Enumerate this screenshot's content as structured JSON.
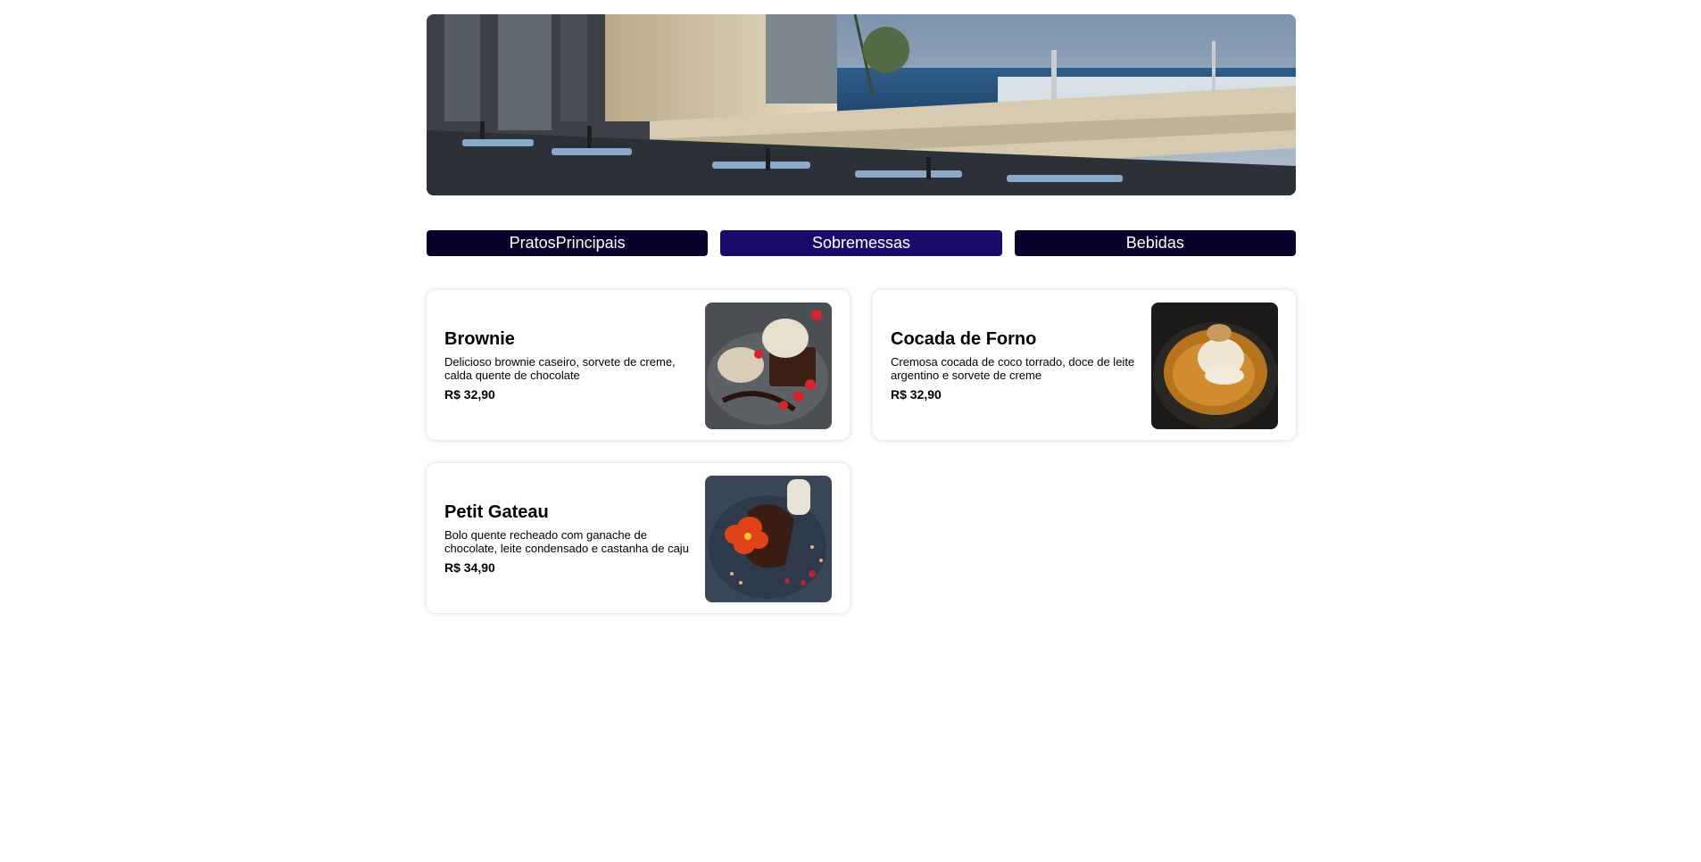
{
  "tabs": [
    {
      "label": "PratosPrincipais",
      "active": false
    },
    {
      "label": "Sobremessas",
      "active": true
    },
    {
      "label": "Bebidas",
      "active": false
    }
  ],
  "items": [
    {
      "name": "Brownie",
      "description": "Delicioso brownie caseiro, sorvete de creme, calda quente de chocolate",
      "price": "R$ 32,90",
      "image_icon": "brownie-photo"
    },
    {
      "name": "Cocada de Forno",
      "description": "Cremosa cocada de coco torrado, doce de leite argentino e sorvete de creme",
      "price": "R$ 32,90",
      "image_icon": "cocada-photo"
    },
    {
      "name": "Petit Gateau",
      "description": "Bolo quente recheado com ganache de chocolate, leite condensado e castanha de caju",
      "price": "R$ 34,90",
      "image_icon": "petit-gateau-photo"
    }
  ],
  "colors": {
    "tab_bg": "#07002a",
    "tab_active_bg": "#1c0a6b",
    "tab_text": "#ffffff"
  }
}
